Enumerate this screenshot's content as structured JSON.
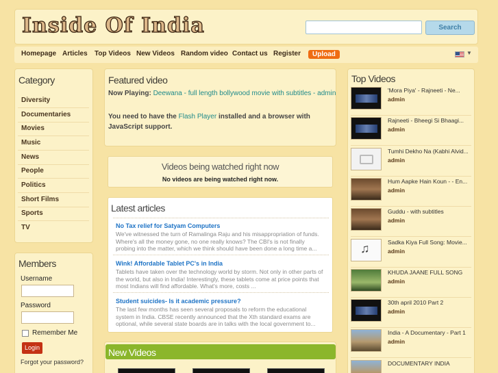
{
  "header": {
    "logo_text": "Inside Of India",
    "search_button": "Search",
    "search_value": ""
  },
  "nav": {
    "items": [
      "Homepage",
      "Articles",
      "Top Videos",
      "New Videos",
      "Random video",
      "Contact us",
      "Register"
    ],
    "upload": "Upload"
  },
  "category": {
    "title": "Category",
    "items": [
      "Diversity",
      "Documentaries",
      "Movies",
      "Music",
      "News",
      "People",
      "Politics",
      "Short Films",
      "Sports",
      "TV"
    ]
  },
  "members": {
    "title": "Members",
    "username_label": "Username",
    "password_label": "Password",
    "remember_label": "Remember Me",
    "login_button": "Login",
    "forgot_link": "Forgot your password?"
  },
  "featured": {
    "title": "Featured video",
    "now_playing_label": "Now Playing:",
    "now_playing_value": "Deewana - full length bollywood movie with subtitles - admin",
    "flash_text_1": "You need to have the",
    "flash_link": "Flash Player",
    "flash_text_2": "installed and a browser with JavaScript support."
  },
  "watching": {
    "title": "Videos being watched right now",
    "empty_text": "No videos are being watched right now."
  },
  "articles": {
    "title": "Latest articles",
    "items": [
      {
        "title": "No Tax relief for Satyam Computers",
        "body": "We've witnessed the turn of Ramalinga Raju and his misappropriation of funds. Where's all the money gone, no one really knows? The CBI's is not finally probing into the matter, which we think should have been done a long time a..."
      },
      {
        "title": "Wink! Affordable Tablet PC's in India",
        "body": "Tablets have taken over the technology world by storm. Not only in other parts of the world, but also in India! Interestingly, these tablets come at price points that most Indians will find affordable. What's more, costs ..."
      },
      {
        "title": "Student suicides- Is it academic pressure?",
        "body": "The last few months has seen several proposals to reform the educational system in India. CBSE recently announced that the Xth standard exams are optional, while several state boards are in talks with the local government to..."
      }
    ]
  },
  "new_videos": {
    "title": "New Videos"
  },
  "top_videos": {
    "title": "Top Videos",
    "items": [
      {
        "title": "'Mora Piya' - Rajneeti - Ne...",
        "user": "admin",
        "thumb": "dark"
      },
      {
        "title": "Rajneeti - Bheegi Si Bhaagi...",
        "user": "admin",
        "thumb": "dark"
      },
      {
        "title": "Tumhi Dekho Na (Kabhi Alvid...",
        "user": "admin",
        "thumb": "placeholder"
      },
      {
        "title": "Hum Aapke Hain Koun - - En...",
        "user": "admin",
        "thumb": "scene"
      },
      {
        "title": "Guddu - with subtitles",
        "user": "admin",
        "thumb": "scene"
      },
      {
        "title": "Sadka Kiya Full Song: Movie...",
        "user": "admin",
        "thumb": "music"
      },
      {
        "title": "KHUDA JAANE FULL SONG",
        "user": "admin",
        "thumb": "green"
      },
      {
        "title": "30th april 2010 Part 2",
        "user": "admin",
        "thumb": "dark"
      },
      {
        "title": "India - A Documentary - Part 1",
        "user": "admin",
        "thumb": "landscape"
      },
      {
        "title": "DOCUMENTARY INDIA",
        "user": "",
        "thumb": "landscape"
      }
    ]
  },
  "colors": {
    "background": "#f7e3a4",
    "panel": "#fcf2c8",
    "link_blue": "#1f74c6",
    "upload_orange": "#ef6c12",
    "new_videos_green": "#8bb62b",
    "login_red": "#c43214"
  }
}
